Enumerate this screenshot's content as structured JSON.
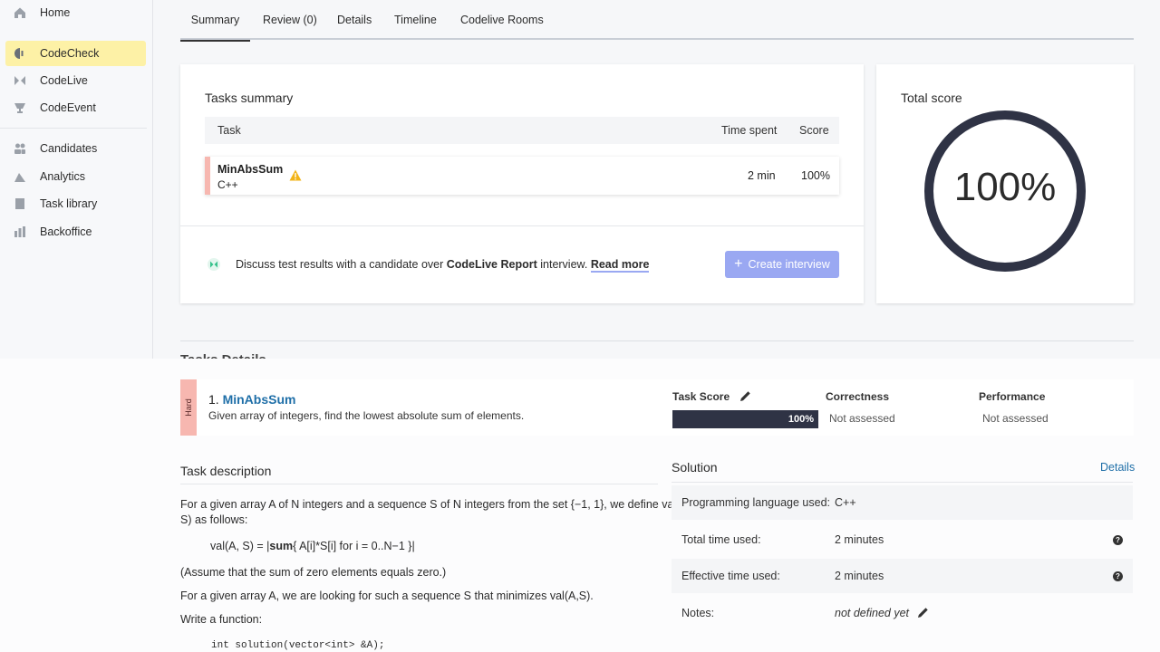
{
  "sidebar": {
    "items": [
      {
        "label": "Home",
        "icon": "home-icon"
      },
      {
        "label": "CodeCheck",
        "icon": "codecheck-icon"
      },
      {
        "label": "CodeLive",
        "icon": "codelive-icon"
      },
      {
        "label": "CodeEvent",
        "icon": "trophy-icon"
      },
      {
        "label": "Candidates",
        "icon": "people-icon"
      },
      {
        "label": "Analytics",
        "icon": "analytics-icon"
      },
      {
        "label": "Task library",
        "icon": "book-icon"
      },
      {
        "label": "Backoffice",
        "icon": "backoffice-icon"
      }
    ]
  },
  "tabs": [
    "Summary",
    "Review (0)",
    "Details",
    "Timeline",
    "Codelive Rooms"
  ],
  "tasks_summary": {
    "title": "Tasks summary",
    "col_task": "Task",
    "col_time": "Time spent",
    "col_score": "Score",
    "row": {
      "name": "MinAbsSum",
      "lang": "C++",
      "time": "2 min",
      "score": "100%"
    },
    "discuss_prefix": "Discuss test results with a candidate over ",
    "discuss_bold": "CodeLive Report",
    "discuss_suffix": " interview. ",
    "read_more": "Read more",
    "create_btn": "Create interview"
  },
  "total_score": {
    "title": "Total score",
    "value": "100%",
    "fraction": 1.0
  },
  "tasks_details": {
    "title": "Tasks Details",
    "difficulty": "Hard",
    "task_number": "1.",
    "task_name": "MinAbsSum",
    "task_summary": "Given array of integers, find the lowest absolute sum of elements.",
    "task_score_label": "Task Score",
    "task_score_value": "100%",
    "task_score_fraction": 1.0,
    "correctness_label": "Correctness",
    "correctness_value": "Not assessed",
    "performance_label": "Performance",
    "performance_value": "Not assessed"
  },
  "task_description": {
    "title": "Task description",
    "p1": "For a given array A of N integers and a sequence S of N integers from the set {−1, 1}, we define val(A,",
    "p1b": "S) as follows:",
    "formula_prefix": "val(A, S) = |",
    "formula_bold": "sum",
    "formula_suffix": "{ A[i]*S[i] for i = 0..N−1 }|",
    "p2": "(Assume that the sum of zero elements equals zero.)",
    "p3": "For a given array A, we are looking for such a sequence S that minimizes val(A,S).",
    "p4": "Write a function:",
    "code": "int solution(vector<int> &A);"
  },
  "solution": {
    "title": "Solution",
    "details_link": "Details",
    "rows": [
      {
        "label": "Programming language used:",
        "value": "C++"
      },
      {
        "label": "Total time used:",
        "value": "2 minutes"
      },
      {
        "label": "Effective time used:",
        "value": "2 minutes"
      },
      {
        "label": "Notes:",
        "value": "not defined yet"
      }
    ]
  },
  "colors": {
    "accent_yellow": "#fdf1a6",
    "flag_red": "#f7b7b0",
    "button_blue": "#9aa8f2",
    "ring": "#2f3345"
  }
}
